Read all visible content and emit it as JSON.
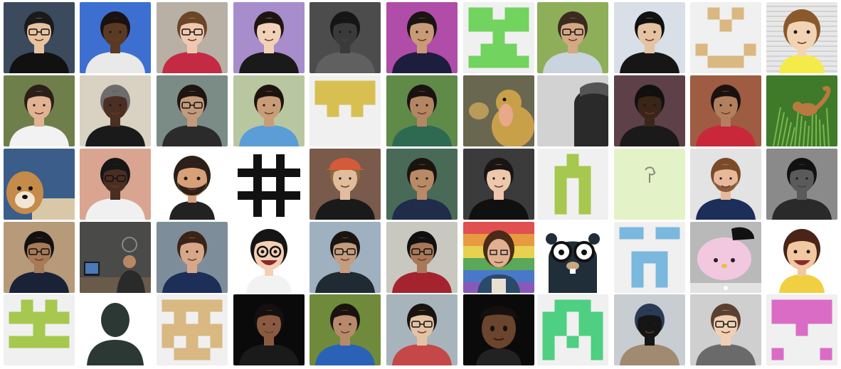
{
  "grid": {
    "rows": [
      [
        {
          "kind": "photo",
          "bg": "#3b4a5c",
          "skin": "#e8c3a0",
          "hair": "#1a1a1a",
          "shirt": "#111111",
          "glasses": true
        },
        {
          "kind": "photo",
          "bg": "#3d6fd1",
          "skin": "#5a3a25",
          "hair": "#1a1210",
          "shirt": "#e9e9e9"
        },
        {
          "kind": "photo",
          "bg": "#b8b0a5",
          "skin": "#f0c8b0",
          "hair": "#6a4528",
          "shirt": "#c42a44",
          "glasses": true
        },
        {
          "kind": "photo",
          "bg": "#a78dcc",
          "skin": "#f1d2b8",
          "hair": "#1e1512",
          "shirt": "#1a1a1a"
        },
        {
          "kind": "photo",
          "bg": "#4c4c4c",
          "skin": "#3a3a3a",
          "hair": "#151515",
          "shirt": "#b84a3a",
          "mono": true
        },
        {
          "kind": "photo",
          "bg": "#b04da8",
          "skin": "#c89a78",
          "hair": "#1a1412",
          "shirt": "#1d1d3d"
        },
        {
          "kind": "identicon",
          "color": "#72d35f",
          "pattern": [
            "11011",
            "11111",
            "00100",
            "01110",
            "11111"
          ]
        },
        {
          "kind": "photo",
          "bg": "#8fae5a",
          "skin": "#d4a884",
          "hair": "#3a2a20",
          "shirt": "#c9d4de",
          "glasses": true
        },
        {
          "kind": "photo",
          "bg": "#d8dfe6",
          "skin": "#e4c2a2",
          "hair": "#111111",
          "shirt": "#161616"
        },
        {
          "kind": "identicon",
          "color": "#d9b882",
          "pattern": [
            "01010",
            "00100",
            "00000",
            "10001",
            "01110"
          ]
        },
        {
          "kind": "cartoon",
          "bg": "#e8e8e8",
          "skin": "#f2d4b4",
          "hair": "#8a5a2c",
          "shirt": "#f3eb4a",
          "lines": true
        }
      ],
      [
        {
          "kind": "photo",
          "bg": "#6e7f4b",
          "skin": "#e2b294",
          "hair": "#2b1f18",
          "shirt": "#f2f2f2"
        },
        {
          "kind": "photo",
          "bg": "#d9d2c2",
          "skin": "#4b2f22",
          "hair": "#6d6d6d",
          "shirt": "#1a1a1a"
        },
        {
          "kind": "photo",
          "bg": "#7a8c85",
          "skin": "#c49a7c",
          "hair": "#1e1410",
          "shirt": "#2b2b2b",
          "glasses": true
        },
        {
          "kind": "photo",
          "bg": "#b9c7a1",
          "skin": "#c99c78",
          "hair": "#1d1410",
          "shirt": "#5b9dd6"
        },
        {
          "kind": "identicon",
          "color": "#d8bf52",
          "pattern": [
            "11111",
            "11111",
            "01010",
            "00000",
            "00000"
          ]
        },
        {
          "kind": "photo",
          "bg": "#5f8a48",
          "skin": "#b58664",
          "hair": "#1a1210",
          "shirt": "#2e6a52"
        },
        {
          "kind": "duck",
          "bg": "#6a6750",
          "body": "#c9a04a",
          "bill": "#e8a88a"
        },
        {
          "kind": "gray",
          "bg": "#d2d2d2",
          "figure": "#2a2a2a"
        },
        {
          "kind": "photo",
          "bg": "#5d4048",
          "skin": "#3b2418",
          "hair": "#101010",
          "shirt": "#1a1a1a"
        },
        {
          "kind": "photo",
          "bg": "#9e5c42",
          "skin": "#b2805e",
          "hair": "#1b1210",
          "shirt": "#c8283a"
        },
        {
          "kind": "squirrel",
          "bg": "#3f7a2a",
          "body": "#b87a3e"
        }
      ],
      [
        {
          "kind": "dog",
          "bg": "#3b5d8a",
          "fur": "#c48b4a"
        },
        {
          "kind": "photo",
          "bg": "#d9a490",
          "skin": "#4a2e22",
          "hair": "#161616",
          "shirt": "#f0f0f0",
          "glasses": true
        },
        {
          "kind": "cartoon",
          "bg": "#ffffff",
          "skin": "#d8a078",
          "hair": "#2c2018",
          "shirt": "#222222",
          "beard": true
        },
        {
          "kind": "hash",
          "bg": "#ffffff",
          "color": "#111111"
        },
        {
          "kind": "photo",
          "bg": "#7a5a4a",
          "skin": "#e1bd9e",
          "hair": "#8c6a3a",
          "shirt": "#1a1a1a",
          "hat": "#d45a3a"
        },
        {
          "kind": "photo",
          "bg": "#4a6a58",
          "skin": "#b88a66",
          "hair": "#1a1410",
          "shirt": "#1f2c4a"
        },
        {
          "kind": "photo",
          "bg": "#3b3b3b",
          "skin": "#edc8ac",
          "hair": "#1a1512",
          "shirt": "#101010"
        },
        {
          "kind": "identicon",
          "color": "#a6c84e",
          "pattern": [
            "00100",
            "01110",
            "01010",
            "01010",
            "01010"
          ]
        },
        {
          "kind": "sketch",
          "bg": "#e4f2c8",
          "color": "#8a8a78"
        },
        {
          "kind": "photo",
          "bg": "#e3e3e3",
          "skin": "#e8b89a",
          "hair": "#7a4a2a",
          "shirt": "#1c2e5a",
          "beard": true
        },
        {
          "kind": "photo",
          "bg": "#8a8a8a",
          "skin": "#5a5a5a",
          "hair": "#111111",
          "shirt": "#2a2a2a",
          "mono": true
        }
      ],
      [
        {
          "kind": "photo",
          "bg": "#b69a7a",
          "skin": "#a87a58",
          "hair": "#151010",
          "shirt": "#1a2238",
          "glasses": true
        },
        {
          "kind": "desk",
          "bg": "#4a4a48",
          "skin": "#b88866",
          "shirt": "#2a2a2a"
        },
        {
          "kind": "photo",
          "bg": "#7d8e9a",
          "skin": "#d6a888",
          "hair": "#3a2418",
          "shirt": "#1d2e58"
        },
        {
          "kind": "cartoon",
          "bg": "#ffffff",
          "skin": "#f4cfb4",
          "hair": "#151515",
          "shirt": "#f2f2f2",
          "glasses": true,
          "smile": true
        },
        {
          "kind": "photo",
          "bg": "#9fb0c0",
          "skin": "#c49c7e",
          "hair": "#1a1410",
          "shirt": "#202a32",
          "glasses": true
        },
        {
          "kind": "photo",
          "bg": "#c8c8c0",
          "skin": "#a8785a",
          "hair": "#101010",
          "shirt": "#a4232e",
          "glasses": true
        },
        {
          "kind": "rainbow",
          "skin": "#e0b090",
          "hair": "#4a2a18",
          "shirt": "#2a4a6a"
        },
        {
          "kind": "gopher",
          "bg": "#ffffff",
          "body": "#1f2e38",
          "face": "#ffffff"
        },
        {
          "kind": "identicon",
          "color": "#7ab8de",
          "pattern": [
            "11011",
            "00000",
            "01110",
            "01010",
            "01010"
          ]
        },
        {
          "kind": "kitty",
          "bg": "#b9b9b9",
          "face": "#f2c8e0"
        },
        {
          "kind": "cartoon",
          "bg": "#ffffff",
          "skin": "#f2c8a0",
          "hair": "#4a2418",
          "shirt": "#f0d040",
          "smile": true
        }
      ],
      [
        {
          "kind": "identicon",
          "color": "#a6c84e",
          "pattern": [
            "01010",
            "11111",
            "00100",
            "11111",
            "00000"
          ]
        },
        {
          "kind": "silhouette",
          "bg": "#ffffff",
          "color": "#2c3833"
        },
        {
          "kind": "identicon",
          "color": "#d9b882",
          "pattern": [
            "11111",
            "01010",
            "11111",
            "10101",
            "01110"
          ]
        },
        {
          "kind": "photo",
          "bg": "#0a0a0a",
          "skin": "#8a5a40",
          "hair": "#151010",
          "shirt": "#1a1a1a"
        },
        {
          "kind": "photo",
          "bg": "#6f8a3a",
          "skin": "#b68a6a",
          "hair": "#1a1210",
          "shirt": "#2a62b8"
        },
        {
          "kind": "photo",
          "bg": "#a8b4bc",
          "skin": "#e4c2a4",
          "hair": "#1a1410",
          "shirt": "#c44848",
          "glasses": true
        },
        {
          "kind": "memoji",
          "bg": "#0a0a0a",
          "skin": "#6a442c",
          "hair": "#151010"
        },
        {
          "kind": "identicon",
          "color": "#4ecf82",
          "pattern": [
            "01110",
            "11011",
            "11011",
            "10101",
            "10001"
          ]
        },
        {
          "kind": "photo",
          "bg": "#c8cdd2",
          "skin": "#151515",
          "hair": "#2b3a55",
          "shirt": "#a08a70"
        },
        {
          "kind": "photo",
          "bg": "#cfcfcf",
          "skin": "#f0d0b4",
          "hair": "#5a4030",
          "shirt": "#6a6a6a",
          "glasses": true
        },
        {
          "kind": "identicon",
          "color": "#da6cc6",
          "pattern": [
            "11111",
            "11111",
            "00100",
            "00000",
            "10001"
          ]
        }
      ]
    ]
  }
}
